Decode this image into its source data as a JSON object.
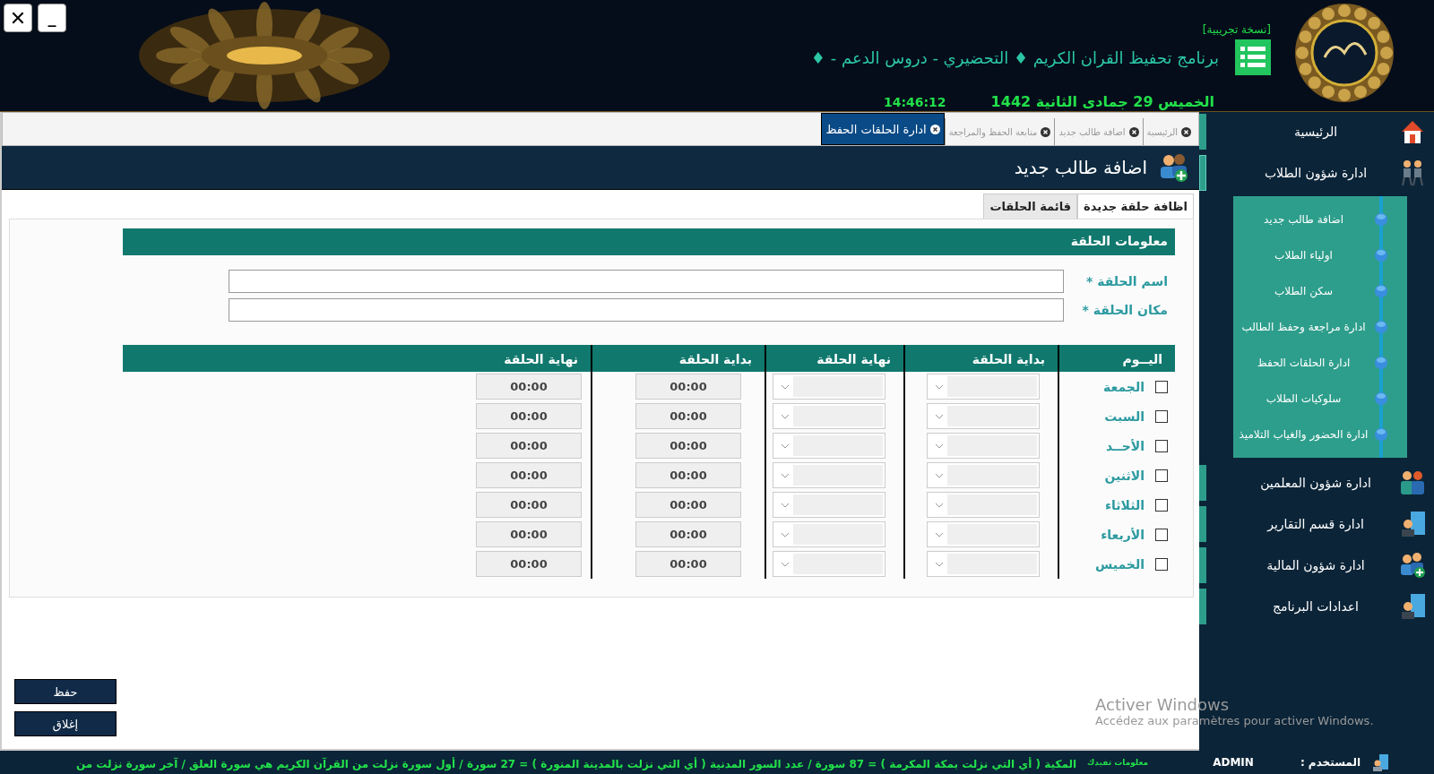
{
  "window": {
    "controls": [
      {
        "kind": "close",
        "label": "✕"
      },
      {
        "kind": "minimize",
        "label": "_"
      }
    ]
  },
  "header": {
    "badge": "[نسخة تجريبية]",
    "title": "برنامج تحفيظ القران الكريم ♦ التحضيري - دروس الدعم - ♦",
    "date": "الخميس 29 جمادى الثانية 1442",
    "time": "14:46:12"
  },
  "open_tabs": [
    {
      "label": "الرئيسية",
      "selected": false
    },
    {
      "label": "اضافة طالب جديد",
      "selected": false
    },
    {
      "label": "متابعة الحفظ والمراجعة",
      "selected": false
    },
    {
      "label": "ادارة الحلقات الحفظ",
      "selected": true
    }
  ],
  "page_title": "اضافة طالب جديد",
  "inner_tabs": [
    {
      "label": "اظافة حلقة جديدة",
      "selected": true
    },
    {
      "label": "قائمة الحلقات",
      "selected": false
    }
  ],
  "section_title": "معلومات الحلقة",
  "fields": [
    {
      "label": "اسم الحلقة *"
    },
    {
      "label": "مكان الحلقة *"
    }
  ],
  "schedule": {
    "columns": [
      "اليــوم",
      "بداية الحلقة",
      "نهاية الحلقة",
      "بداية الحلقة",
      "نهاية الحلقة"
    ],
    "rows": [
      {
        "day": "الجمعة",
        "checked": false,
        "times": [
          "00:00",
          "00:00"
        ]
      },
      {
        "day": "السبت",
        "checked": false,
        "times": [
          "00:00",
          "00:00"
        ]
      },
      {
        "day": "الأحــد",
        "checked": false,
        "times": [
          "00:00",
          "00:00"
        ]
      },
      {
        "day": "الاثنين",
        "checked": false,
        "times": [
          "00:00",
          "00:00"
        ]
      },
      {
        "day": "الثلاثاء",
        "checked": false,
        "times": [
          "00:00",
          "00:00"
        ]
      },
      {
        "day": "الأربعاء",
        "checked": false,
        "times": [
          "00:00",
          "00:00"
        ]
      },
      {
        "day": "الخميس",
        "checked": false,
        "times": [
          "00:00",
          "00:00"
        ]
      }
    ]
  },
  "buttons": [
    "حفظ",
    "إغلاق"
  ],
  "sidebar": {
    "items": [
      {
        "label": "الرئيسية",
        "expanded": false
      },
      {
        "label": "ادارة شؤون الطلاب",
        "expanded": true,
        "children": [
          {
            "label": "اضافة طالب جديد"
          },
          {
            "label": "اولياء الطلاب"
          },
          {
            "label": "سكن الطلاب"
          },
          {
            "label": "ادارة مراجعة وحفظ الطالب"
          },
          {
            "label": "ادارة الحلقات الحفظ"
          },
          {
            "label": "سلوكيات الطلاب"
          },
          {
            "label": "ادارة الحضور والغياب التلاميذ"
          }
        ]
      },
      {
        "label": "ادارة شؤون المعلمين",
        "expanded": false
      },
      {
        "label": "ادارة قسم التقارير",
        "expanded": false
      },
      {
        "label": "ادارة شؤون المالية",
        "expanded": false
      },
      {
        "label": "اعدادات البرنامج",
        "expanded": false
      }
    ]
  },
  "status_bar": {
    "user_label": "المستخدم :",
    "user": "ADMIN",
    "info_label": "معلومات تفيدك",
    "ticker": "المكية ( أي التي نزلت بمكة المكرمة ) = 87 سورة / عدد السور المدنية ( أي التي نزلت بالمدينة المنورة ) = 27 سورة / أول سورة نزلت من القرآن الكريم هي سورة العلق / آخر سورة نزلت من"
  },
  "os_notice": {
    "title": "Activer Windows",
    "text": "Accédez aux paramètres pour activer Windows."
  }
}
